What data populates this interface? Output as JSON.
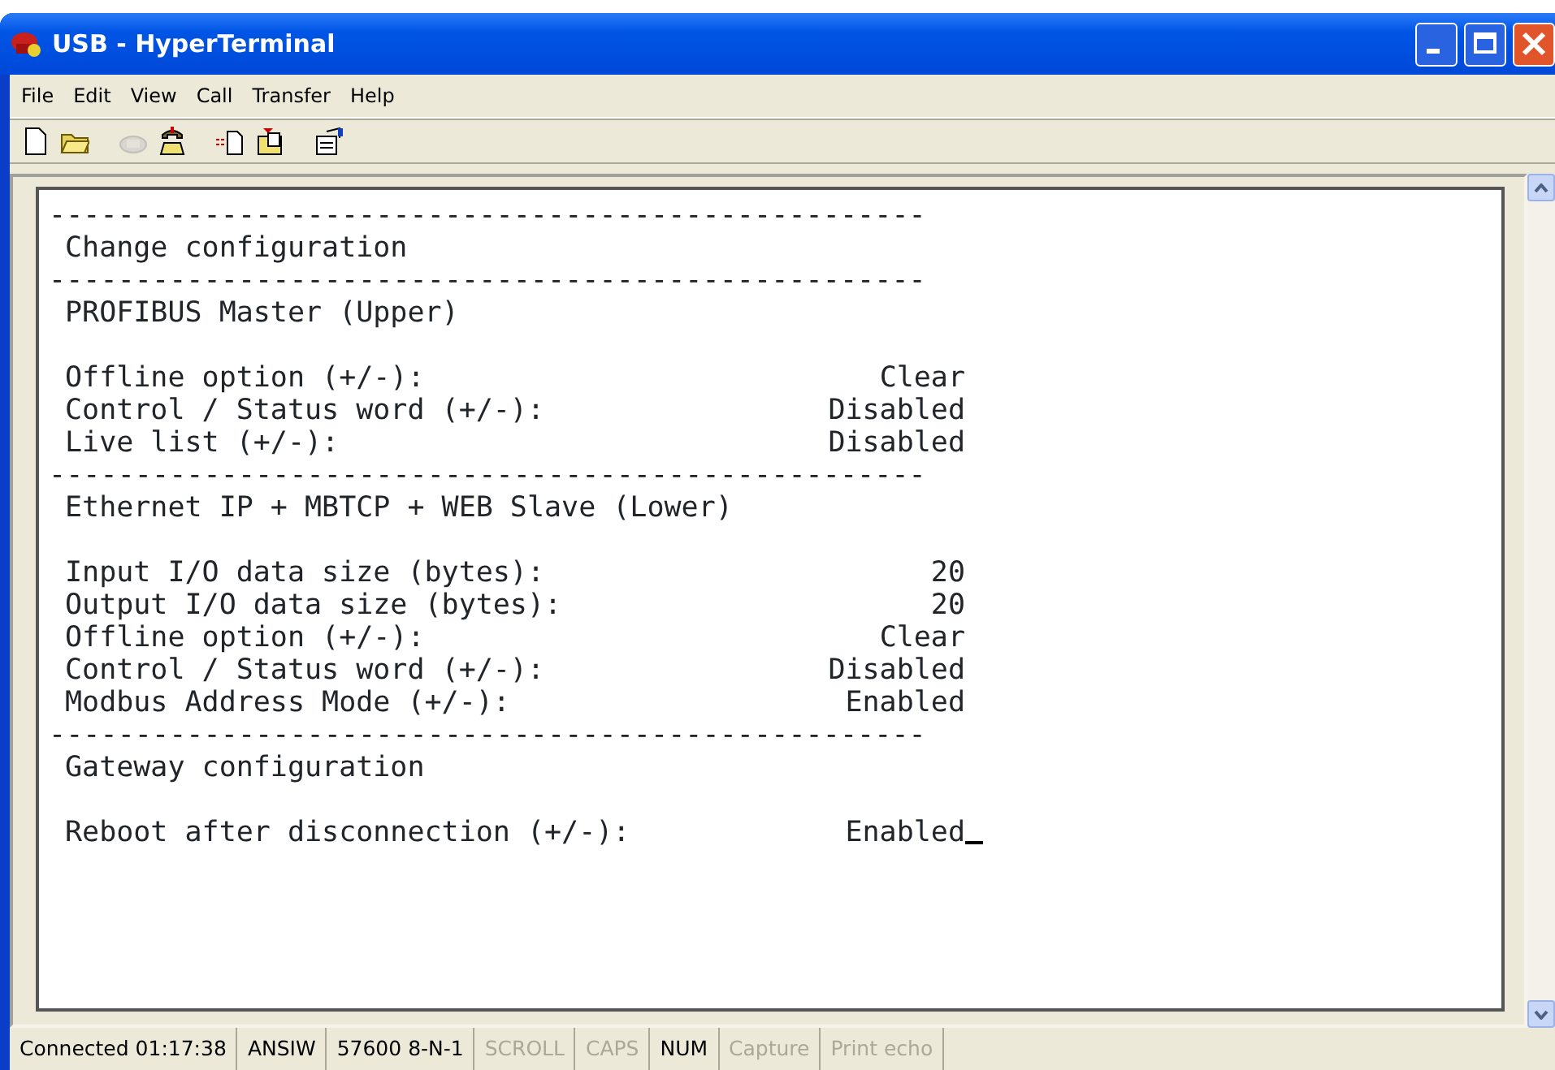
{
  "window": {
    "title": "USB - HyperTerminal"
  },
  "menu": [
    "File",
    "Edit",
    "View",
    "Call",
    "Transfer",
    "Help"
  ],
  "toolbar": [
    {
      "kind": "new",
      "disabled": false
    },
    {
      "kind": "open",
      "disabled": false
    },
    {
      "kind": "call",
      "disabled": true
    },
    {
      "kind": "hangup",
      "disabled": false
    },
    {
      "kind": "send",
      "disabled": false
    },
    {
      "kind": "receive",
      "disabled": false
    },
    {
      "kind": "properties",
      "disabled": false
    }
  ],
  "terminal": {
    "cursor": true,
    "lines": [
      {
        "kind": "rule",
        "text": "---------------------------------------------------"
      },
      {
        "kind": "text",
        "text": "Change configuration"
      },
      {
        "kind": "rule",
        "text": "---------------------------------------------------"
      },
      {
        "kind": "text",
        "text": "PROFIBUS Master (Upper)"
      },
      {
        "kind": "blank"
      },
      {
        "kind": "field",
        "label": "Offline option (+/-):",
        "value": "Clear"
      },
      {
        "kind": "field",
        "label": "Control / Status word (+/-):",
        "value": "Disabled"
      },
      {
        "kind": "field",
        "label": "Live list (+/-):",
        "value": "Disabled"
      },
      {
        "kind": "rule",
        "text": "---------------------------------------------------"
      },
      {
        "kind": "text",
        "text": "Ethernet IP + MBTCP + WEB Slave (Lower)"
      },
      {
        "kind": "blank"
      },
      {
        "kind": "field",
        "label": "Input I/O data size (bytes):",
        "value": "20"
      },
      {
        "kind": "field",
        "label": "Output I/O data size (bytes):",
        "value": "20"
      },
      {
        "kind": "field",
        "label": "Offline option (+/-):",
        "value": "Clear"
      },
      {
        "kind": "field",
        "label": "Control / Status word (+/-):",
        "value": "Disabled"
      },
      {
        "kind": "field",
        "label": "Modbus Address Mode (+/-):",
        "value": "Enabled"
      },
      {
        "kind": "rule",
        "text": "---------------------------------------------------"
      },
      {
        "kind": "text",
        "text": "Gateway configuration"
      },
      {
        "kind": "blank"
      },
      {
        "kind": "field",
        "label": "Reboot after disconnection (+/-):",
        "value": "Enabled"
      }
    ]
  },
  "status_bar": [
    {
      "text": "Connected 01:17:38",
      "disabled": false
    },
    {
      "text": "ANSIW",
      "disabled": false
    },
    {
      "text": "57600 8-N-1",
      "disabled": false
    },
    {
      "text": "SCROLL",
      "disabled": true
    },
    {
      "text": "CAPS",
      "disabled": true
    },
    {
      "text": "NUM",
      "disabled": false
    },
    {
      "text": "Capture",
      "disabled": true
    },
    {
      "text": "Print echo",
      "disabled": true
    }
  ]
}
